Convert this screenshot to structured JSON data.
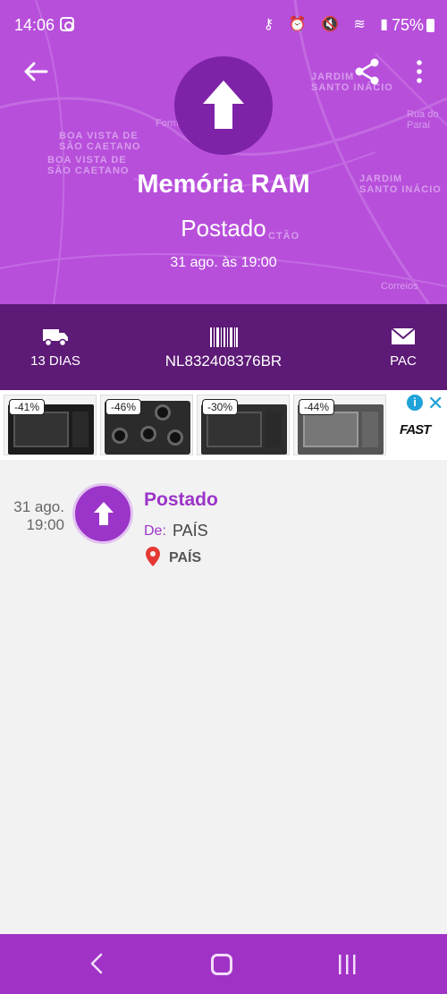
{
  "status_bar": {
    "time": "14:06",
    "icons": "⚷ ⏰ 🔇 ≋ ▮",
    "battery": "75%"
  },
  "map_labels": [
    "JARDIM\nSANTO INÁCIO",
    "BOA VISTA DE\nSÃO CAETANO",
    "BOA VISTA DE\nSÃO CAETANO",
    "JARDIM\nSANTO INÁCIO",
    "Forma",
    "Rua do Paraí",
    "CTÃO",
    "Correios"
  ],
  "header": {
    "title": "Memória RAM",
    "status": "Postado",
    "date": "31 ago. às 19:00"
  },
  "info": {
    "days": "13 DIAS",
    "tracking_code": "NL832408376BR",
    "service": "PAC"
  },
  "ad": {
    "discounts": [
      "-41%",
      "-46%",
      "-30%",
      "-44%"
    ],
    "logo": "FAST"
  },
  "event": {
    "date_line1": "31 ago.",
    "date_line2": "19:00",
    "title": "Postado",
    "from_label": "De:",
    "from_value": "PAÍS",
    "location": "PAÍS"
  },
  "colors": {
    "header": "#b74fdb",
    "band": "#5d1a76",
    "accent": "#9b34c8",
    "navbar": "#a033c6"
  }
}
